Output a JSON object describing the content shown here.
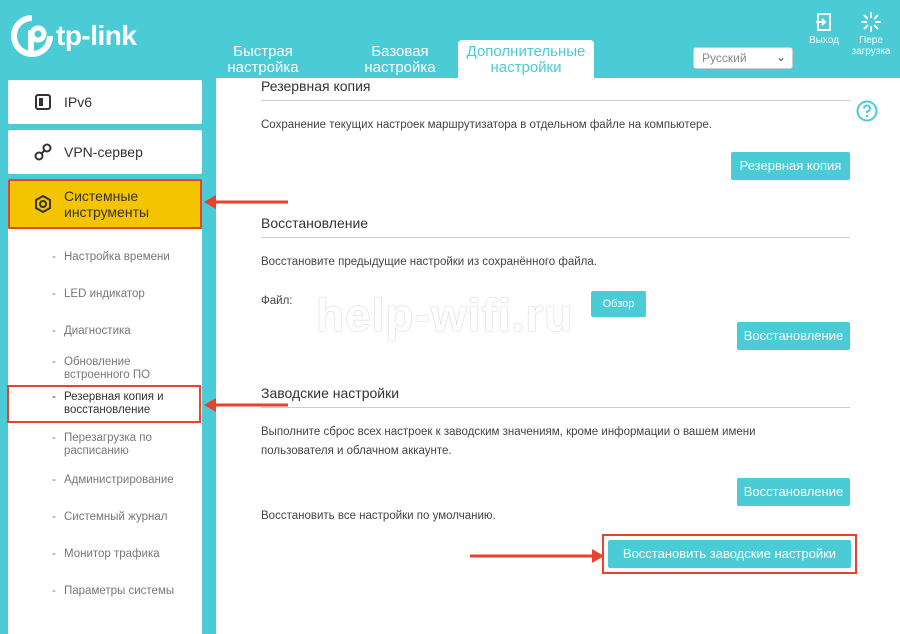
{
  "header": {
    "logo_text": "tp-link",
    "tabs": [
      {
        "label": "Быстрая настройка"
      },
      {
        "label": "Базовая настройка"
      },
      {
        "label": "Дополнительные настройки"
      }
    ],
    "language": "Русский",
    "logout_label": "Выход",
    "reboot_label": "Пере загрузка"
  },
  "sidebar": {
    "items": [
      {
        "label": "IPv6",
        "icon": "ipv6-icon"
      },
      {
        "label": "VPN-сервер",
        "icon": "vpn-icon"
      },
      {
        "label": "Системные инструменты",
        "icon": "system-tools-icon"
      }
    ],
    "subitems": [
      {
        "label": "Настройка времени"
      },
      {
        "label": "LED индикатор"
      },
      {
        "label": "Диагностика"
      },
      {
        "label": "Обновление встроенного ПО"
      },
      {
        "label": "Резервная копия и восстановление"
      },
      {
        "label": "Перезагрузка по расписанию"
      },
      {
        "label": "Администрирование"
      },
      {
        "label": "Системный журнал"
      },
      {
        "label": "Монитор трафика"
      },
      {
        "label": "Параметры системы"
      }
    ]
  },
  "main": {
    "backup": {
      "title": "Резервная копия",
      "description": "Сохранение текущих настроек маршрутизатора в отдельном файле на компьютере.",
      "button": "Резервная копия"
    },
    "restore": {
      "title": "Восстановление",
      "description": "Восстановите предыдущие настройки из сохранённого файла.",
      "file_label": "Файл:",
      "browse_button": "Обзор",
      "button": "Восстановление"
    },
    "factory": {
      "title": "Заводские настройки",
      "description": "Выполните сброс всех настроек к заводским значениям, кроме информации о вашем имени пользователя и облачном аккаунте.",
      "button": "Восстановление",
      "default_text": "Восстановить все настройки по умолчанию.",
      "factory_button": "Восстановить заводские настройки"
    },
    "watermark": "help-wifi.ru"
  },
  "colors": {
    "brand": "#4acbd6",
    "highlight": "#f5c400",
    "annotation": "#e8412c"
  }
}
